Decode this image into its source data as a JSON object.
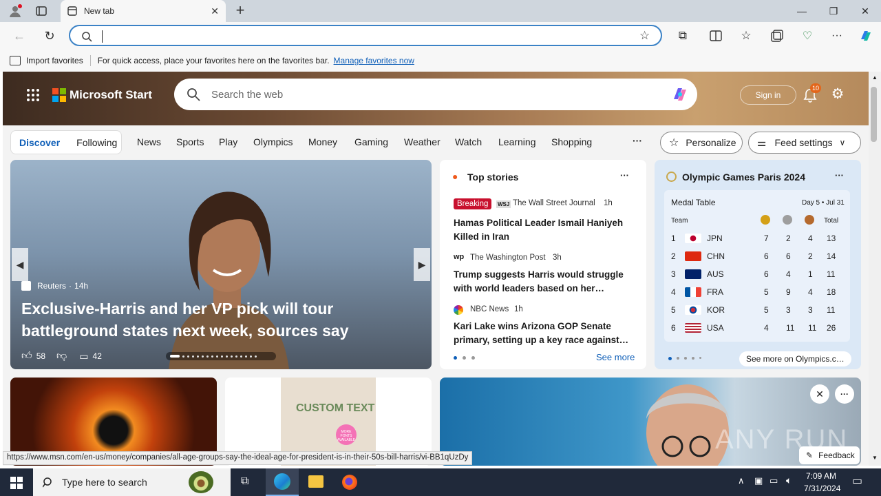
{
  "browser": {
    "tab_title": "New tab",
    "address_value": "",
    "favorites_bar": {
      "import_label": "Import favorites",
      "hint_text": "For quick access, place your favorites here on the favorites bar.",
      "manage_link": "Manage favorites now"
    }
  },
  "header": {
    "brand": "Microsoft Start",
    "search_placeholder": "Search the web",
    "sign_in": "Sign in",
    "notification_count": "10"
  },
  "nav": {
    "discover": "Discover",
    "following": "Following",
    "items": [
      "News",
      "Sports",
      "Play",
      "Olympics",
      "Money",
      "Gaming",
      "Weather",
      "Watch",
      "Learning",
      "Shopping"
    ],
    "more": "···",
    "personalize": "Personalize",
    "feed_settings": "Feed settings"
  },
  "hero": {
    "source": "Reuters",
    "age": "14h",
    "title": "Exclusive-Harris and her VP pick will tour battleground states next week, sources say",
    "likes": "58",
    "comments": "42"
  },
  "top_stories": {
    "title": "Top stories",
    "more": "···",
    "stories": [
      {
        "badge": "Breaking",
        "source": "The Wall Street Journal",
        "age": "1h",
        "headline": "Hamas Political Leader Ismail Haniyeh Killed in Iran"
      },
      {
        "badge": "",
        "source": "The Washington Post",
        "age": "3h",
        "headline": "Trump suggests Harris would struggle with world leaders based on her…"
      },
      {
        "badge": "",
        "source": "NBC News",
        "age": "1h",
        "headline": "Kari Lake wins Arizona GOP Senate primary, setting up a key race against…"
      }
    ],
    "see_more": "See more"
  },
  "olympics": {
    "title": "Olympic Games Paris 2024",
    "more": "···",
    "table_title": "Medal Table",
    "day_info": "Day 5 • Jul 31",
    "team_header": "Team",
    "total_header": "Total",
    "rows": [
      {
        "rank": "1",
        "team": "JPN",
        "gold": "7",
        "silver": "2",
        "bronze": "4",
        "total": "13"
      },
      {
        "rank": "2",
        "team": "CHN",
        "gold": "6",
        "silver": "6",
        "bronze": "2",
        "total": "14"
      },
      {
        "rank": "3",
        "team": "AUS",
        "gold": "6",
        "silver": "4",
        "bronze": "1",
        "total": "11"
      },
      {
        "rank": "4",
        "team": "FRA",
        "gold": "5",
        "silver": "9",
        "bronze": "4",
        "total": "18"
      },
      {
        "rank": "5",
        "team": "KOR",
        "gold": "5",
        "silver": "3",
        "bronze": "3",
        "total": "11"
      },
      {
        "rank": "6",
        "team": "USA",
        "gold": "4",
        "silver": "11",
        "bronze": "11",
        "total": "26"
      }
    ],
    "see_more": "See more on Olympics.c…"
  },
  "promo": {
    "shirt_text": "CUSTOM TEXT",
    "tag_text": "MORE FONTS AVAILABLE"
  },
  "feedback": "Feedback",
  "watermark": "ANY RUN",
  "status_url": "https://www.msn.com/en-us/money/companies/all-age-groups-say-the-ideal-age-for-president-is-in-their-50s-bill-harris/vi-BB1qUzDy",
  "taskbar": {
    "search_placeholder": "Type here to search",
    "time": "7:09 AM",
    "date": "7/31/2024"
  }
}
